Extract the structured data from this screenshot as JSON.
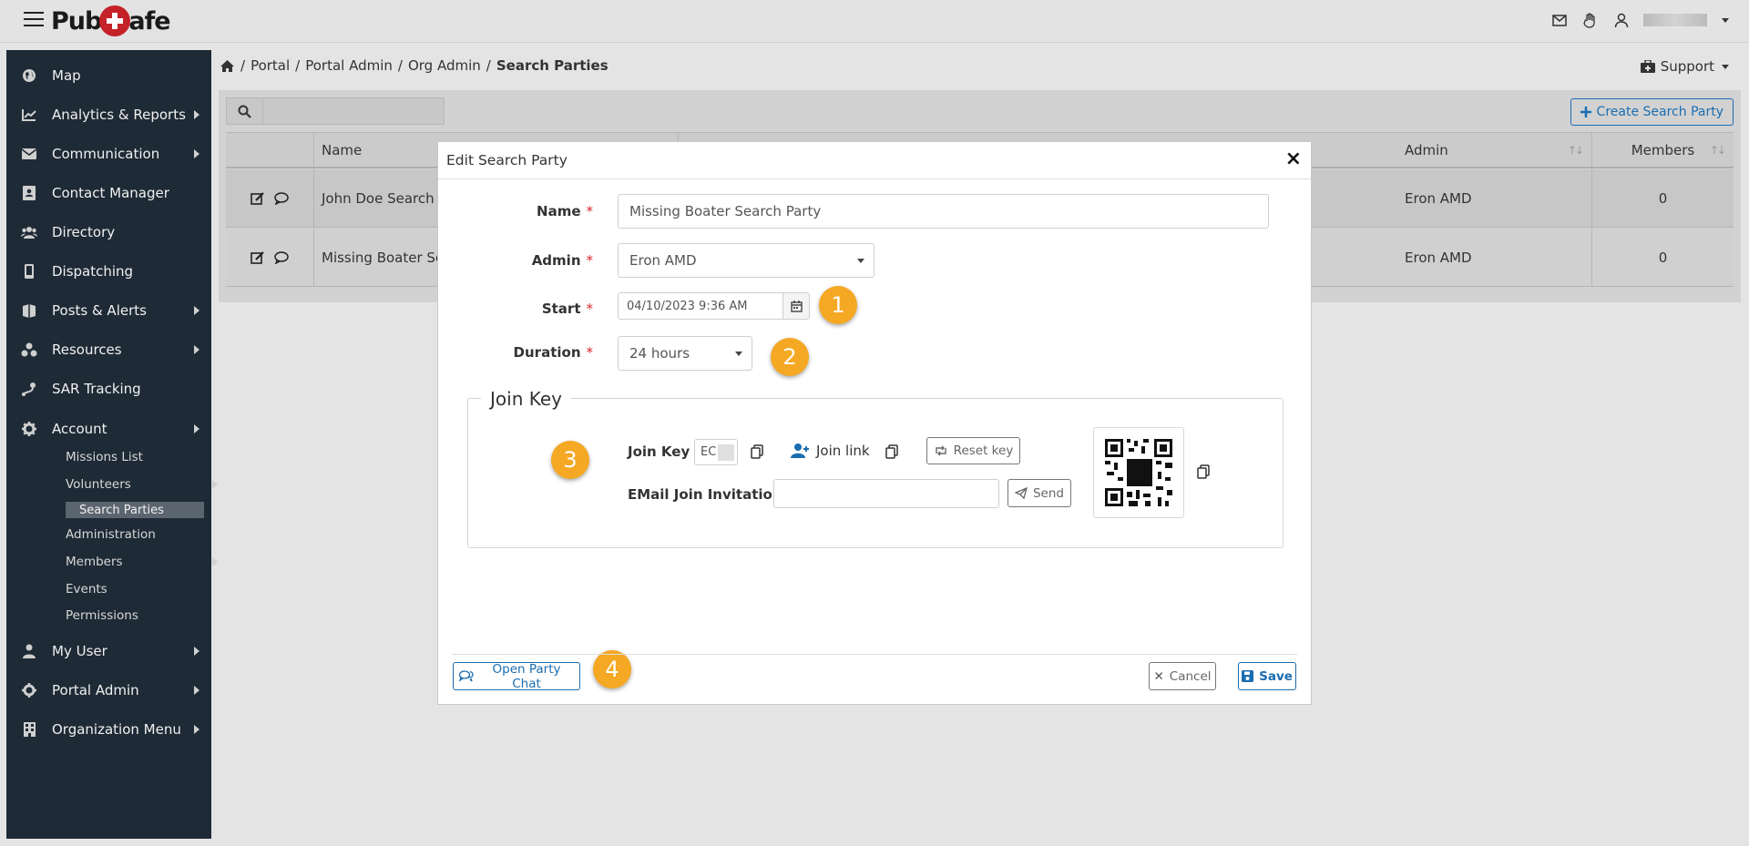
{
  "app": {
    "logo_text_left": "Pub",
    "logo_text_right": "afe"
  },
  "topbar": {
    "icons": [
      "envelope-icon",
      "hand-icon",
      "user-icon"
    ]
  },
  "sidebar": {
    "items": [
      {
        "label": "Map",
        "icon": "globe-icon"
      },
      {
        "label": "Analytics & Reports",
        "icon": "chart-icon"
      },
      {
        "label": "Communication",
        "icon": "envelope-icon"
      },
      {
        "label": "Contact Manager",
        "icon": "address-book-icon"
      },
      {
        "label": "Directory",
        "icon": "users-icon"
      },
      {
        "label": "Dispatching",
        "icon": "mobile-icon"
      },
      {
        "label": "Posts & Alerts",
        "icon": "posts-icon"
      },
      {
        "label": "Resources",
        "icon": "resources-icon"
      },
      {
        "label": "SAR Tracking",
        "icon": "tracking-icon"
      },
      {
        "label": "Account",
        "icon": "gear-icon"
      },
      {
        "label": "My User",
        "icon": "user-icon"
      },
      {
        "label": "Portal Admin",
        "icon": "gear-icon"
      },
      {
        "label": "Organization Menu",
        "icon": "building-icon"
      }
    ],
    "account_sub": [
      {
        "label": "Missions List"
      },
      {
        "label": "Volunteers"
      },
      {
        "label": "Search Parties"
      },
      {
        "label": "Administration"
      },
      {
        "label": "Members"
      },
      {
        "label": "Events"
      },
      {
        "label": "Permissions"
      }
    ]
  },
  "breadcrumb": {
    "items": [
      "Portal",
      "Portal Admin",
      "Org Admin"
    ],
    "current": "Search Parties"
  },
  "support_label": "Support",
  "toolbar": {
    "create_label": "Create Search Party"
  },
  "table": {
    "headers": {
      "name": "Name",
      "admin": "Admin",
      "members": "Members"
    },
    "rows": [
      {
        "name": "John Doe Search P",
        "admin": "Eron AMD",
        "members": "0"
      },
      {
        "name": "Missing Boater Sea",
        "admin": "Eron AMD",
        "members": "0"
      }
    ]
  },
  "modal": {
    "title": "Edit Search Party",
    "close": "×",
    "name_label": "Name",
    "name_value": "Missing Boater Search Party",
    "admin_label": "Admin",
    "admin_value": "Eron AMD",
    "start_label": "Start",
    "start_value": "04/10/2023 9:36 AM",
    "duration_label": "Duration",
    "duration_value": "24 hours",
    "required_mark": "*",
    "join_key_legend": "Join Key",
    "join_key_label": "Join Key",
    "join_key_value": "EC",
    "join_link_label": "Join link",
    "reset_key_label": "Reset key",
    "email_label": "EMail Join Invitation",
    "send_label": "Send",
    "open_chat_label": "Open Party Chat",
    "cancel_label": "Cancel",
    "save_label": "Save"
  },
  "callouts": [
    "1",
    "2",
    "3",
    "4"
  ],
  "colors": {
    "sidebar_bg": "#1e2a36",
    "accent": "#1a6db0",
    "required": "#d9262c",
    "callout": "#f5a823",
    "brand_red": "#c42228"
  }
}
